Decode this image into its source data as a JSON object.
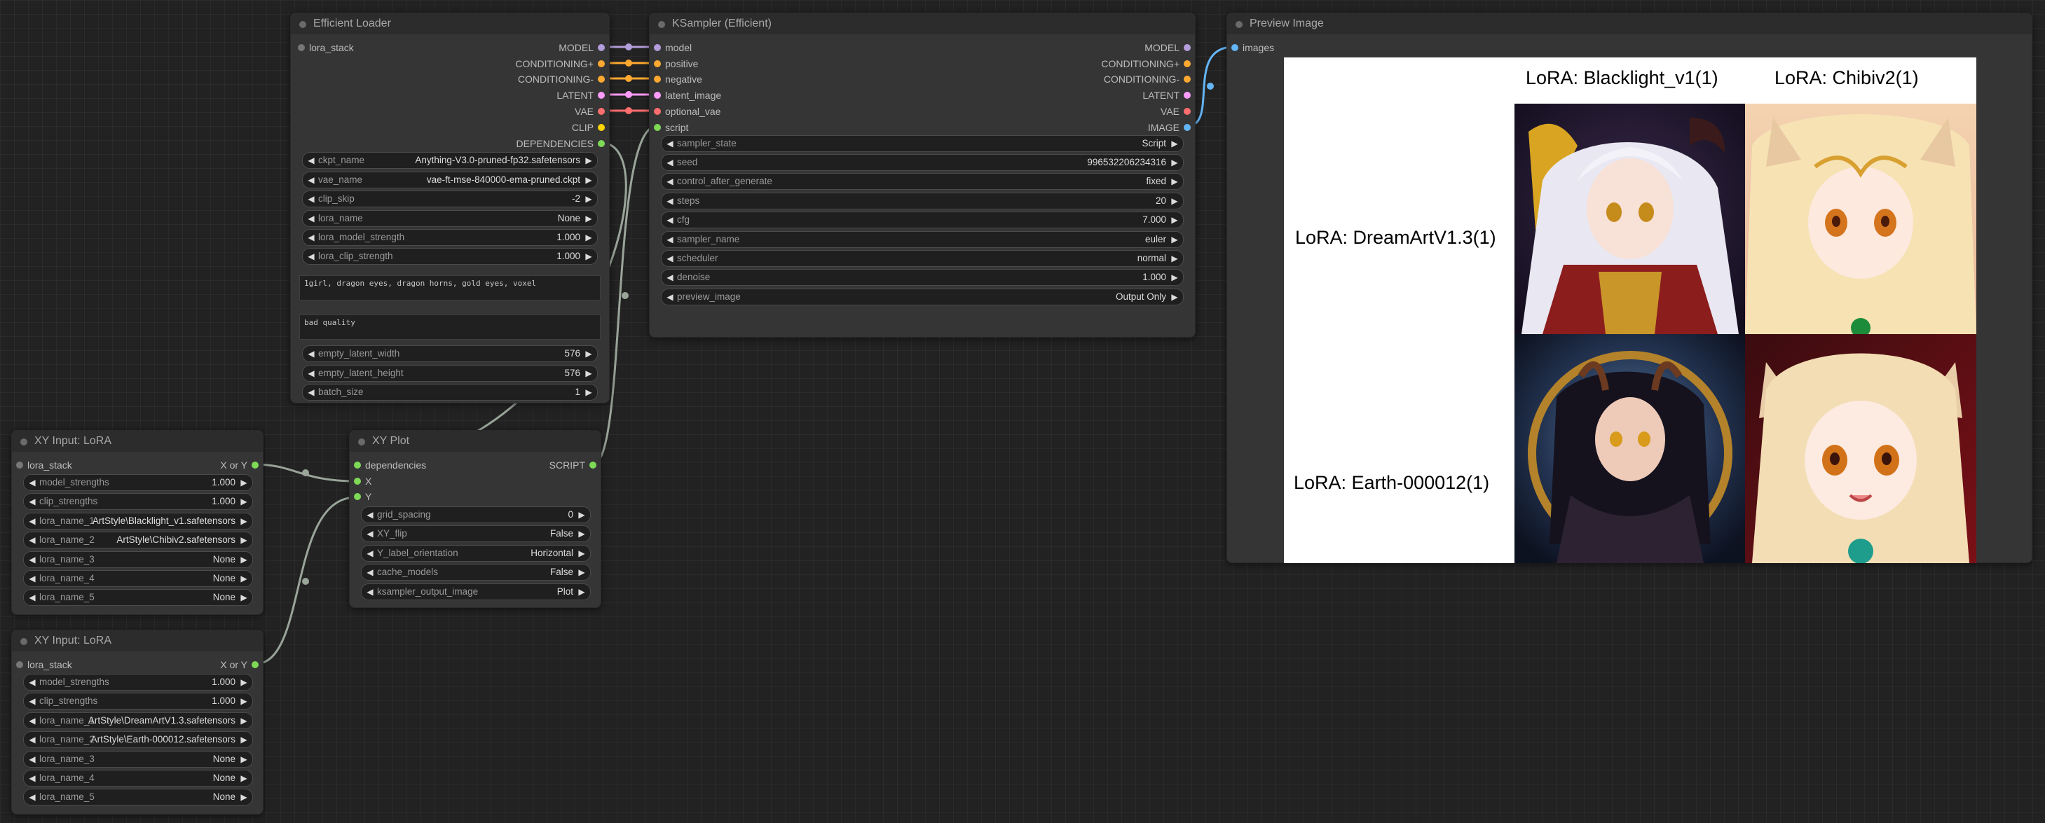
{
  "colors": {
    "model": "#b39ddb",
    "conditioning": "#ffa931",
    "latent": "#ff9cf9",
    "vae": "#ff6e6e",
    "clip": "#ffd500",
    "dependencies": "#7ed957",
    "script": "#7ed957",
    "image": "#64b5f6"
  },
  "efficient_loader": {
    "title": "Efficient Loader",
    "input_lora_stack": "lora_stack",
    "outputs": [
      "MODEL",
      "CONDITIONING+",
      "CONDITIONING-",
      "LATENT",
      "VAE",
      "CLIP",
      "DEPENDENCIES"
    ],
    "widgets": [
      {
        "label": "ckpt_name",
        "value": "Anything-V3.0-pruned-fp32.safetensors"
      },
      {
        "label": "vae_name",
        "value": "vae-ft-mse-840000-ema-pruned.ckpt"
      },
      {
        "label": "clip_skip",
        "value": "-2"
      },
      {
        "label": "lora_name",
        "value": "None"
      },
      {
        "label": "lora_model_strength",
        "value": "1.000"
      },
      {
        "label": "lora_clip_strength",
        "value": "1.000"
      }
    ],
    "positive_prompt": "1girl, dragon eyes, dragon horns, gold eyes, voxel",
    "negative_prompt": "bad quality",
    "latent_widgets": [
      {
        "label": "empty_latent_width",
        "value": "576"
      },
      {
        "label": "empty_latent_height",
        "value": "576"
      },
      {
        "label": "batch_size",
        "value": "1"
      }
    ]
  },
  "ksampler": {
    "title": "KSampler (Efficient)",
    "inputs": [
      "model",
      "positive",
      "negative",
      "latent_image",
      "optional_vae",
      "script"
    ],
    "outputs": [
      "MODEL",
      "CONDITIONING+",
      "CONDITIONING-",
      "LATENT",
      "VAE",
      "IMAGE"
    ],
    "widgets": [
      {
        "label": "sampler_state",
        "value": "Script"
      },
      {
        "label": "seed",
        "value": "996532206234316"
      },
      {
        "label": "control_after_generate",
        "value": "fixed"
      },
      {
        "label": "steps",
        "value": "20"
      },
      {
        "label": "cfg",
        "value": "7.000"
      },
      {
        "label": "sampler_name",
        "value": "euler"
      },
      {
        "label": "scheduler",
        "value": "normal"
      },
      {
        "label": "denoise",
        "value": "1.000"
      },
      {
        "label": "preview_image",
        "value": "Output Only"
      }
    ]
  },
  "preview": {
    "title": "Preview Image",
    "input_images": "images",
    "col_labels": [
      "LoRA:  Blacklight_v1(1)",
      "LoRA:  Chibiv2(1)"
    ],
    "row_labels": [
      "LoRA: DreamArtV1.3(1)",
      "LoRA: Earth-000012(1)"
    ]
  },
  "xy_input_1": {
    "title": "XY Input: LoRA",
    "input": "lora_stack",
    "output": "X or Y",
    "widgets": [
      {
        "label": "model_strengths",
        "value": "1.000"
      },
      {
        "label": "clip_strengths",
        "value": "1.000"
      },
      {
        "label": "lora_name_1",
        "value": "ArtStyle\\Blacklight_v1.safetensors"
      },
      {
        "label": "lora_name_2",
        "value": "ArtStyle\\Chibiv2.safetensors"
      },
      {
        "label": "lora_name_3",
        "value": "None"
      },
      {
        "label": "lora_name_4",
        "value": "None"
      },
      {
        "label": "lora_name_5",
        "value": "None"
      }
    ]
  },
  "xy_input_2": {
    "title": "XY Input: LoRA",
    "input": "lora_stack",
    "output": "X or Y",
    "widgets": [
      {
        "label": "model_strengths",
        "value": "1.000"
      },
      {
        "label": "clip_strengths",
        "value": "1.000"
      },
      {
        "label": "lora_name_1",
        "value": "ArtStyle\\DreamArtV1.3.safetensors"
      },
      {
        "label": "lora_name_2",
        "value": "ArtStyle\\Earth-000012.safetensors"
      },
      {
        "label": "lora_name_3",
        "value": "None"
      },
      {
        "label": "lora_name_4",
        "value": "None"
      },
      {
        "label": "lora_name_5",
        "value": "None"
      }
    ]
  },
  "xy_plot": {
    "title": "XY Plot",
    "inputs": [
      "dependencies",
      "X",
      "Y"
    ],
    "output": "SCRIPT",
    "widgets": [
      {
        "label": "grid_spacing",
        "value": "0"
      },
      {
        "label": "XY_flip",
        "value": "False"
      },
      {
        "label": "Y_label_orientation",
        "value": "Horizontal"
      },
      {
        "label": "cache_models",
        "value": "False"
      },
      {
        "label": "ksampler_output_image",
        "value": "Plot"
      }
    ]
  }
}
